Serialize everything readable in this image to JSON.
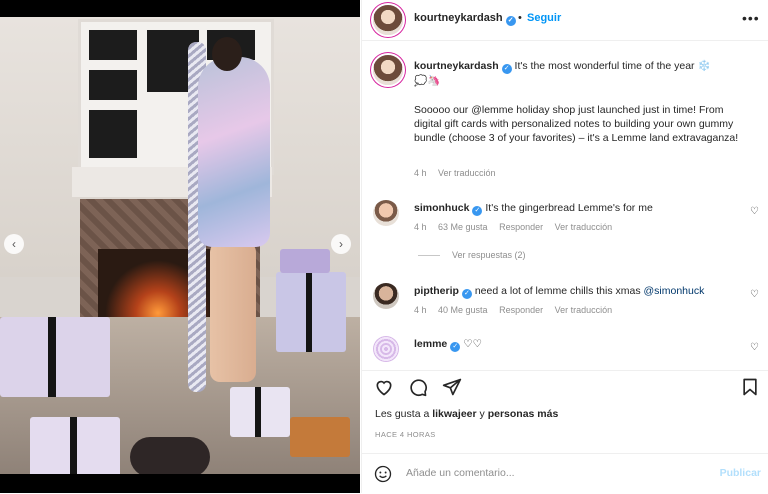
{
  "header": {
    "username": "kourtneykardash",
    "separator": "•",
    "follow_label": "Seguir",
    "more_label": "•••"
  },
  "caption": {
    "username": "kourtneykardash",
    "line1": "It's the most wonderful time of the year ❄️",
    "line2": "💭🦄",
    "body": "Sooooo our @lemme holiday shop just launched just in time! From digital gift cards with personalized notes to building your own gummy bundle (choose 3 of your favorites) – it's a Lemme land extravaganza!",
    "time": "4 h",
    "translate": "Ver traducción"
  },
  "comments": [
    {
      "username": "simonhuck",
      "text": "It's the gingerbread Lemme's for me",
      "time": "4 h",
      "likes": "63 Me gusta",
      "reply": "Responder",
      "translate": "Ver traducción"
    },
    {
      "username": "piptherip",
      "text_before": "need a lot of lemme chills this xmas",
      "mention": "@simonhuck",
      "time": "4 h",
      "likes": "40 Me gusta",
      "reply": "Responder",
      "translate": "Ver traducción"
    },
    {
      "username": "lemme",
      "text": "♡♡"
    }
  ],
  "view_replies": "Ver respuestas (2)",
  "likes": {
    "prefix": "Les gusta a",
    "user": "likwajeer",
    "middle": "y",
    "others": "personas más"
  },
  "posted_ago": "HACE 4 HORAS",
  "comment_input": {
    "placeholder": "Añade un comentario...",
    "post_label": "Publicar"
  },
  "colors": {
    "accent": "#0095f6",
    "verified": "#3897f0",
    "muted": "#8e8e8e"
  }
}
